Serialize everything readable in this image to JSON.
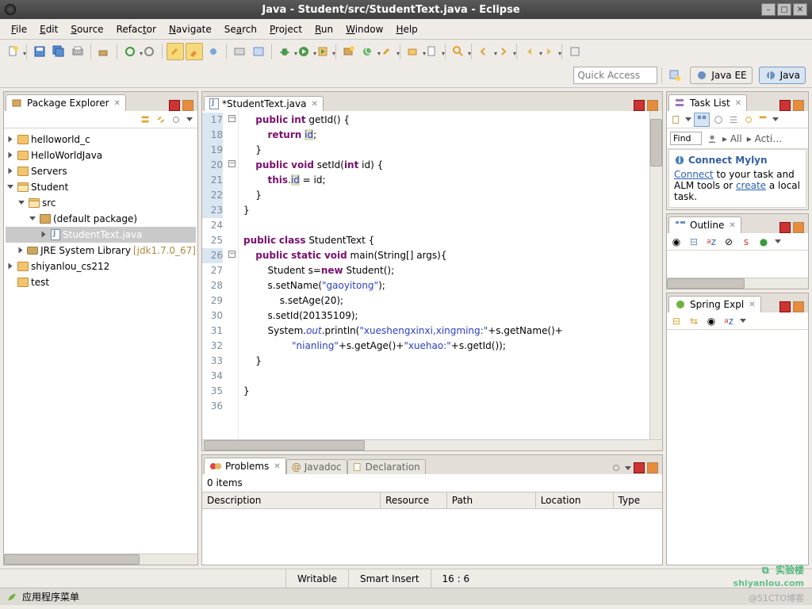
{
  "window": {
    "title": "Java - Student/src/StudentText.java - Eclipse"
  },
  "menu": {
    "file": "File",
    "edit": "Edit",
    "source": "Source",
    "refactor": "Refactor",
    "navigate": "Navigate",
    "search": "Search",
    "project": "Project",
    "run": "Run",
    "window": "Window",
    "help": "Help"
  },
  "quick_access": {
    "placeholder": "Quick Access"
  },
  "perspectives": {
    "javaee": "Java EE",
    "java": "Java"
  },
  "package_explorer": {
    "title": "Package Explorer",
    "tree": [
      {
        "label": "helloworld_c",
        "depth": 0,
        "expanded": false,
        "icon": "folder"
      },
      {
        "label": "HelloWorldJava",
        "depth": 0,
        "expanded": false,
        "icon": "folder"
      },
      {
        "label": "Servers",
        "depth": 0,
        "expanded": false,
        "icon": "folder"
      },
      {
        "label": "Student",
        "depth": 0,
        "expanded": true,
        "icon": "folder"
      },
      {
        "label": "src",
        "depth": 1,
        "expanded": true,
        "icon": "pkgfolder"
      },
      {
        "label": "(default package)",
        "depth": 2,
        "expanded": true,
        "icon": "package"
      },
      {
        "label": "StudentText.java",
        "depth": 3,
        "expanded": false,
        "icon": "jfile",
        "selected": true
      },
      {
        "label": "JRE System Library",
        "suffix": "[jdk1.7.0_67]",
        "depth": 1,
        "expanded": false,
        "icon": "lib"
      },
      {
        "label": "shiyanlou_cs212",
        "depth": 0,
        "expanded": false,
        "icon": "folder"
      },
      {
        "label": "test",
        "depth": 0,
        "expanded": false,
        "icon": "folder",
        "noexpander": true
      }
    ]
  },
  "editor": {
    "tab_label": "*StudentText.java",
    "first_line": 17,
    "lines": [
      {
        "n": 17,
        "hl": true,
        "fold": "-",
        "html": "    <span class='kw'>public</span> <span class='kw'>int</span> getId() {"
      },
      {
        "n": 18,
        "hl": true,
        "html": "        <span class='kw'>return</span> <span class='fld2'>id</span>;"
      },
      {
        "n": 19,
        "hl": true,
        "html": "    }"
      },
      {
        "n": 20,
        "hl": true,
        "fold": "-",
        "html": "    <span class='kw'>public</span> <span class='kw'>void</span> setId(<span class='kw'>int</span> id) {"
      },
      {
        "n": 21,
        "hl": true,
        "html": "        <span class='kw'>this</span>.<span class='fld2'>id</span> = id;"
      },
      {
        "n": 22,
        "hl": true,
        "html": "    }"
      },
      {
        "n": 23,
        "hl": true,
        "html": "}"
      },
      {
        "n": 24,
        "html": ""
      },
      {
        "n": 25,
        "html": "<span class='kw'>public</span> <span class='kw'>class</span> StudentText {"
      },
      {
        "n": 26,
        "hl": true,
        "fold": "-",
        "html": "    <span class='kw'>public</span> <span class='kw'>static</span> <span class='kw'>void</span> main(String[] <span class='typ'>args</span>){"
      },
      {
        "n": 27,
        "html": "        Student s=<span class='kw'>new</span> Student();"
      },
      {
        "n": 28,
        "html": "        s.setName(<span class='str'>\"gaoyitong\"</span>);"
      },
      {
        "n": 29,
        "html": "            s.setAge(20);"
      },
      {
        "n": 30,
        "html": "        s.setId(20135109);"
      },
      {
        "n": 31,
        "html": "        System.<span class='sty'>out</span>.println(<span class='str'>\"xueshengxinxi,xingming:\"</span>+s.getName()+"
      },
      {
        "n": 32,
        "html": "                <span class='str'>\"nianling\"</span>+s.getAge()+<span class='str'>\"xuehao:\"</span>+s.getId());"
      },
      {
        "n": 33,
        "html": "    }"
      },
      {
        "n": 34,
        "html": ""
      },
      {
        "n": 35,
        "html": "}"
      },
      {
        "n": 36,
        "html": ""
      }
    ]
  },
  "problems": {
    "tab": "Problems",
    "javadoc_tab": "Javadoc",
    "declaration_tab": "Declaration",
    "summary": "0 items",
    "columns": {
      "description": "Description",
      "resource": "Resource",
      "path": "Path",
      "location": "Location",
      "type": "Type"
    }
  },
  "tasklist": {
    "title": "Task List",
    "find": "Find",
    "all": "All",
    "activate": "Acti…",
    "mylyn": {
      "heading": "Connect Mylyn",
      "text1": " to your task and ALM tools or ",
      "connect": "Connect",
      "create": "create",
      "text2": " a local task."
    }
  },
  "outline": {
    "title": "Outline"
  },
  "spring": {
    "title": "Spring Expl"
  },
  "status": {
    "writable": "Writable",
    "insert": "Smart Insert",
    "pos": "16 : 6"
  },
  "taskbar": {
    "app_menu": "应用程序菜单"
  },
  "branding": {
    "cn": "实验楼",
    "en": "shiyanlou.com",
    "watermark": "@51CTO博客"
  }
}
